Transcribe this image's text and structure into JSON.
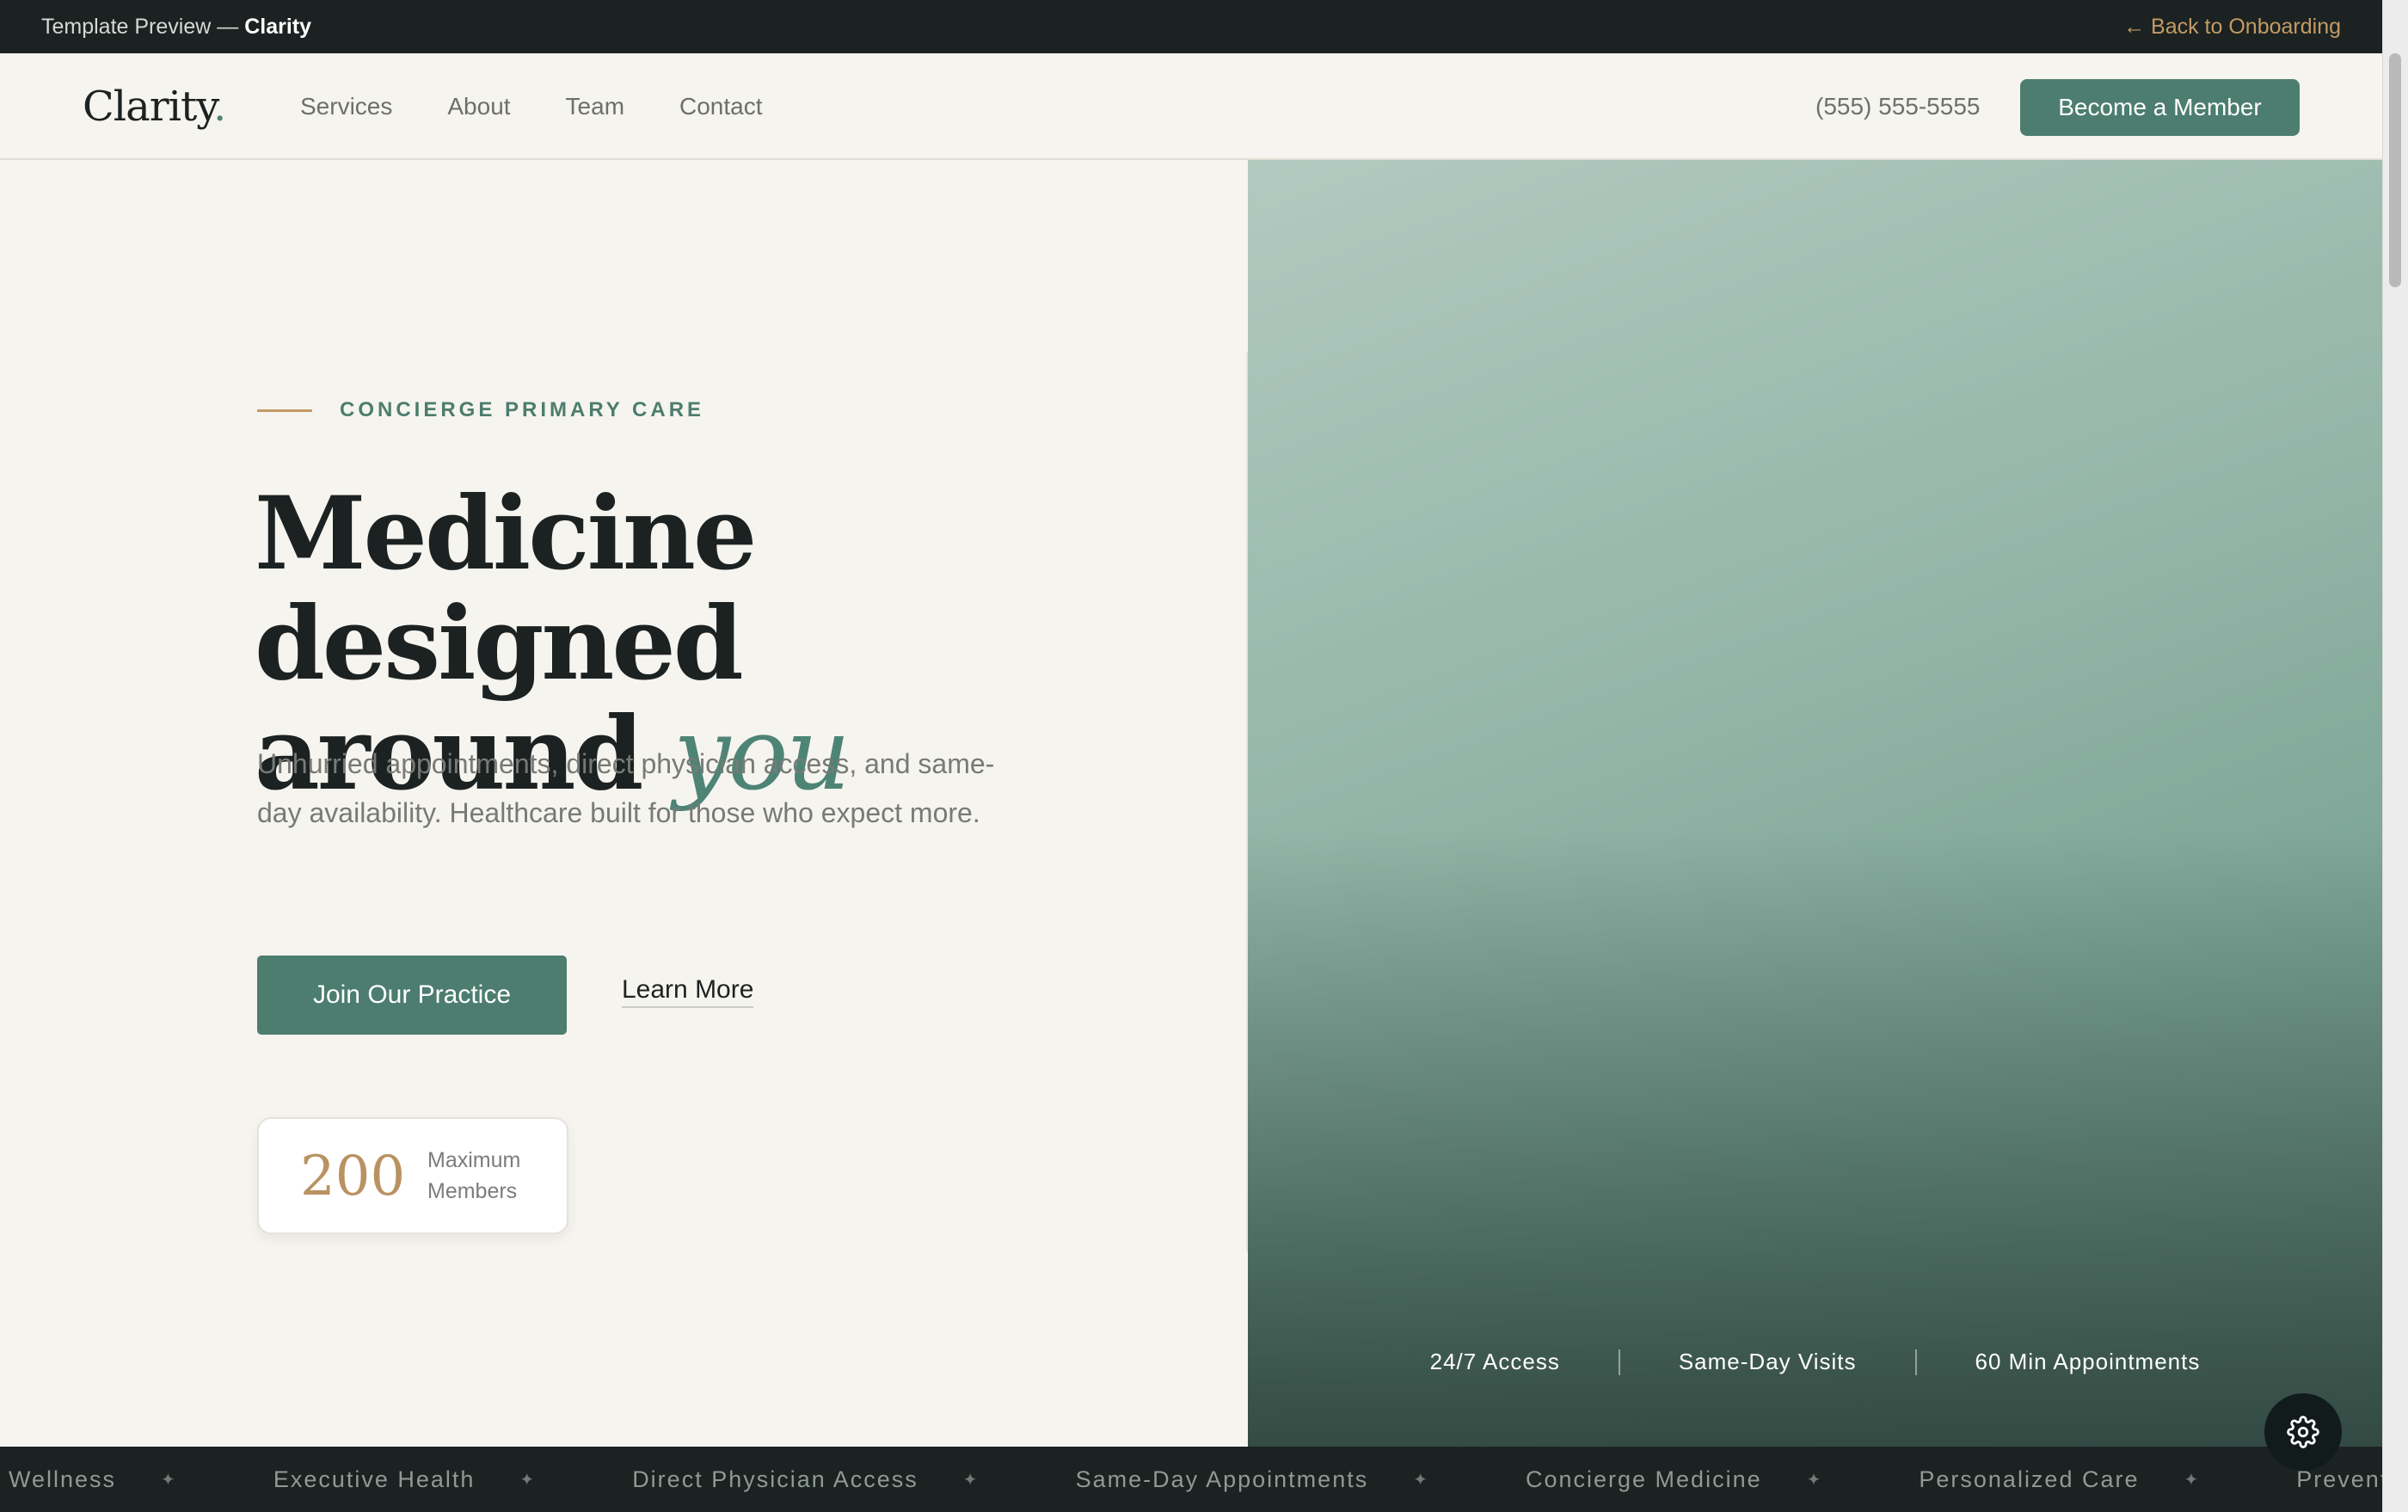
{
  "preview_bar": {
    "prefix": "Template Preview — ",
    "template_name": "Clarity",
    "back_link": "← Back to Onboarding"
  },
  "navbar": {
    "logo": "Clarity",
    "logo_dot": ".",
    "links": [
      "Services",
      "About",
      "Team",
      "Contact"
    ],
    "phone": "(555) 555-5555",
    "cta": "Become a Member"
  },
  "hero": {
    "eyebrow": "CONCIERGE PRIMARY CARE",
    "headline_line1": "Medicine designed",
    "headline_line2_prefix": "around ",
    "headline_accent": "you",
    "subtext": "Unhurried appointments, direct physician access, and same-day availability. Healthcare built for those who expect more.",
    "primary_button": "Join Our Practice",
    "secondary_link": "Learn More",
    "stat": {
      "number": "200",
      "label": "Maximum Members"
    }
  },
  "features": [
    "24/7 Access",
    "Same-Day Visits",
    "60 Min Appointments"
  ],
  "ticker": [
    "Wellness",
    "Executive Health",
    "Direct Physician Access",
    "Same-Day Appointments",
    "Concierge Medicine",
    "Personalized Care",
    "Preventive Wellness"
  ],
  "icons": {
    "settings": "gear-icon",
    "ticker_separator": "star-icon"
  },
  "colors": {
    "accent": "#4c7d6f",
    "gold": "#c49a64",
    "dark": "#1b2221",
    "background": "#f6f4ef"
  }
}
